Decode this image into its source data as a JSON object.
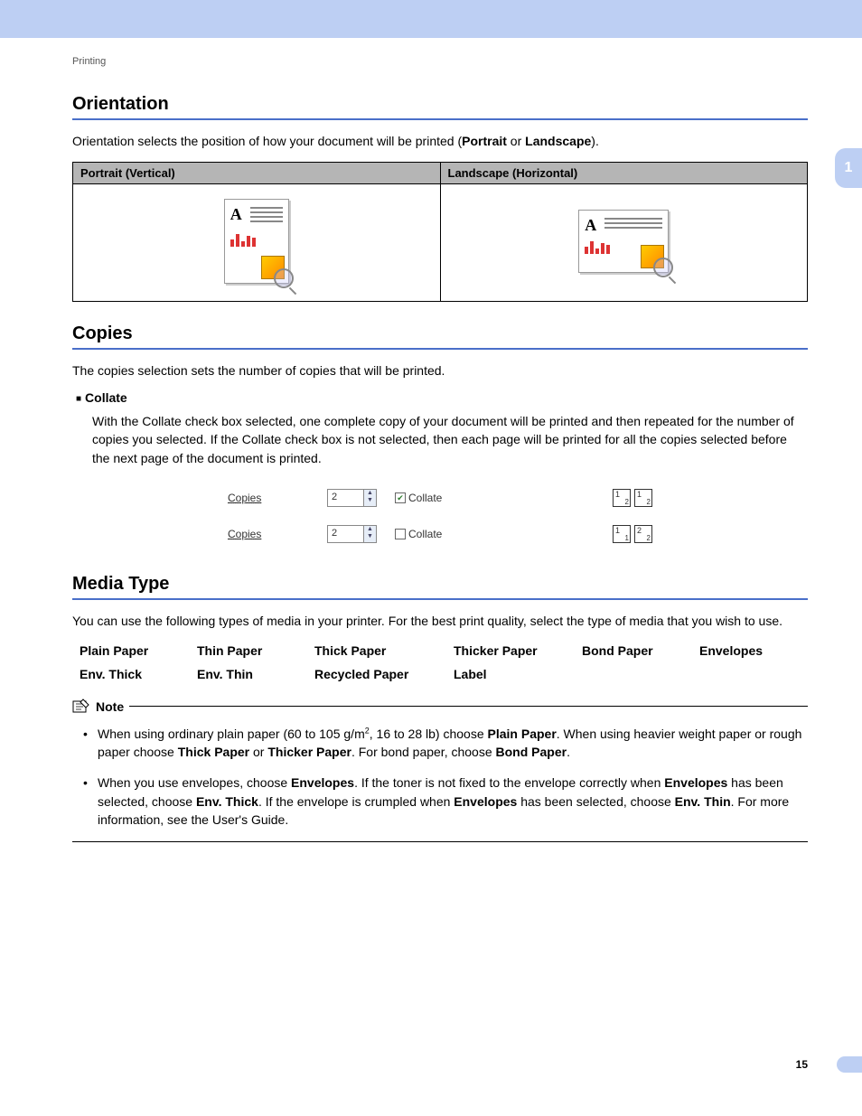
{
  "breadcrumb": "Printing",
  "side_tab": "1",
  "page_number": "15",
  "orientation": {
    "heading": "Orientation",
    "intro_pre": "Orientation selects the position of how your document will be printed (",
    "bold_portrait": "Portrait",
    "mid": " or ",
    "bold_landscape": "Landscape",
    "intro_post": ").",
    "col_portrait": "Portrait (Vertical)",
    "col_landscape": "Landscape (Horizontal)"
  },
  "copies": {
    "heading": "Copies",
    "intro": "The copies selection sets the number of copies that will be printed.",
    "collate_label": "Collate",
    "collate_body": "With the Collate check box selected, one complete copy of your document will be printed and then repeated for the number of copies you selected. If the Collate check box is not selected, then each page will be printed for all the copies selected before the next page of the document is printed.",
    "row_label": "Copies",
    "row_value": "2",
    "chk_label": "Collate"
  },
  "media": {
    "heading": "Media Type",
    "intro": "You can use the following types of media in your printer. For the best print quality, select the type of media that you wish to use.",
    "types": [
      "Plain Paper",
      "Thin Paper",
      "Thick Paper",
      "Thicker Paper",
      "Bond Paper",
      "Envelopes",
      "Env. Thick",
      "Env. Thin",
      "Recycled Paper",
      "Label"
    ],
    "note_label": "Note",
    "note1": {
      "t1": "When using ordinary plain paper (60 to 105 g/m",
      "sup": "2",
      "t2": ", 16 to 28 lb) choose ",
      "b1": "Plain Paper",
      "t3": ". When using heavier weight paper or rough paper choose ",
      "b2": "Thick Paper",
      "t4": " or ",
      "b3": "Thicker Paper",
      "t5": ". For bond paper, choose ",
      "b4": "Bond Paper",
      "t6": "."
    },
    "note2": {
      "t1": "When you use envelopes, choose ",
      "b1": "Envelopes",
      "t2": ". If the toner is not fixed to the envelope correctly when ",
      "b2": "Envelopes",
      "t3": " has been selected, choose ",
      "b3": "Env. Thick",
      "t4": ". If the envelope is crumpled when ",
      "b4": "Envelopes",
      "t5": " has been selected, choose ",
      "b5": "Env. Thin",
      "t6": ". For more information, see the User's Guide."
    }
  }
}
